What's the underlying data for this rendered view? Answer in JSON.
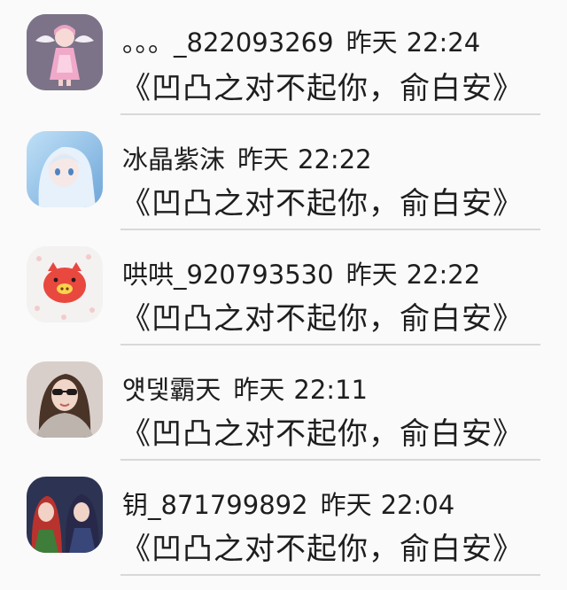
{
  "comments": [
    {
      "name": "。。。_822093269",
      "date": "昨天",
      "time": "22:24",
      "text": "《凹凸之对不起你，俞白安》",
      "avatar": "pink-angel-girl-avatar"
    },
    {
      "name": "冰晶紫沫",
      "date": "昨天",
      "time": "22:22",
      "text": "《凹凸之对不起你，俞白安》",
      "avatar": "blue-anime-girl-avatar"
    },
    {
      "name": "哄哄_920793530",
      "date": "昨天",
      "time": "22:22",
      "text": "《凹凸之对不起你，俞白安》",
      "avatar": "red-pig-avatar"
    },
    {
      "name": "얫뎇霸天",
      "date": "昨天",
      "time": "22:11",
      "text": "《凹凸之对不起你，俞白安》",
      "avatar": "woman-sunglasses-avatar"
    },
    {
      "name": "钥_871799892",
      "date": "昨天",
      "time": "22:04",
      "text": "《凹凸之对不起你，俞白安》",
      "avatar": "anime-duo-avatar"
    }
  ]
}
